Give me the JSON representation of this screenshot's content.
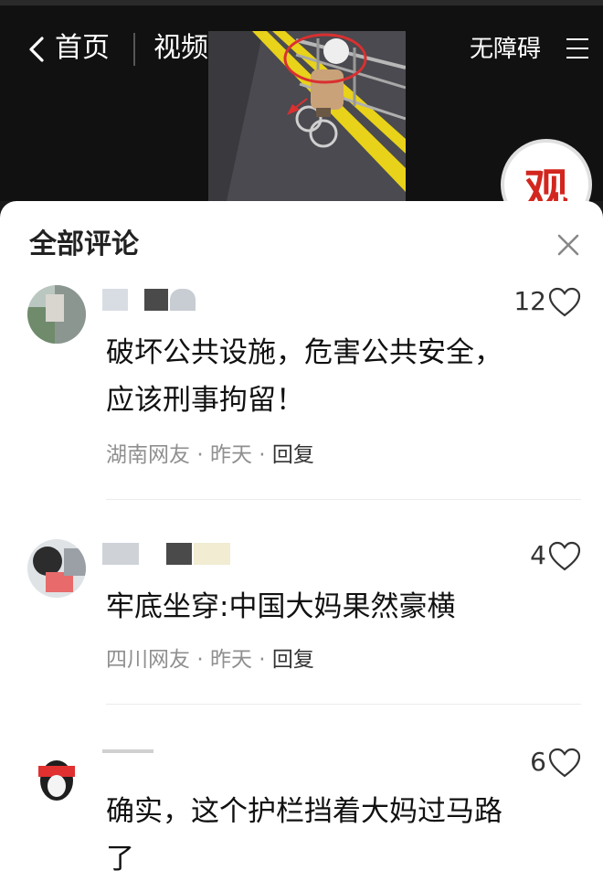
{
  "header": {
    "home_label": "首页",
    "video_label": "视频",
    "accessibility_label": "无障碍",
    "logo_text": "观"
  },
  "sheet": {
    "title": "全部评论"
  },
  "comments": [
    {
      "likes": "12",
      "text_line1": "破坏公共设施，危害公共安全，",
      "text_line2": "应该刑事拘留！",
      "location": "湖南网友",
      "time": "昨天",
      "reply": "回复",
      "separator": "·"
    },
    {
      "likes": "4",
      "text_line1": "牢底坐穿:中国大妈果然豪横",
      "location": "四川网友",
      "time": "昨天",
      "reply": "回复",
      "separator": "·"
    },
    {
      "likes": "6",
      "text_line1": "确实，这个护栏挡着大妈过马路",
      "text_line2": "了"
    }
  ],
  "colors": {
    "accent_red": "#d2261e",
    "meta_gray": "#8f8f8f"
  }
}
